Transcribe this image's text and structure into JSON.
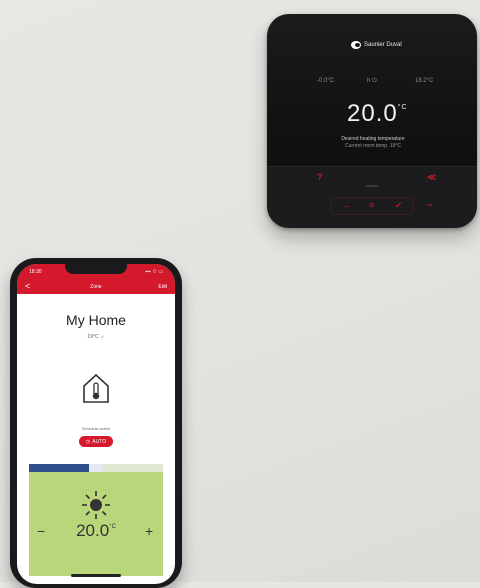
{
  "thermostat": {
    "brand": "Saunier Duval",
    "outdoor_temp": "-0.0°C",
    "mode": "h ⏻",
    "indoor_temp": "18.2°C",
    "setpoint": "20.0",
    "setpoint_unit": "°C",
    "desc_line1": "Desired heating temperature",
    "desc_line2": "Current room temp. 19°C",
    "buttons": {
      "help": "?",
      "back": "←",
      "menu": "≡",
      "ok": "✓",
      "fan": "≪",
      "minus": "−"
    }
  },
  "phone": {
    "status_time": "18:30",
    "status_signal": "▪▪▪ ⌔ ▭",
    "app_back": "<",
    "app_title": "Zone",
    "app_edit": "Edit",
    "home_title": "My Home",
    "home_sub": "19°C ☼",
    "schedule_label": "Schedule active",
    "auto_label": "AUTO",
    "setpoint": "20.0",
    "setpoint_unit": "°C",
    "minus": "−",
    "plus": "+"
  },
  "colors": {
    "brand_red": "#d4192c",
    "panel_green": "#b9d77a",
    "strip_blue": "#2f4f8a"
  }
}
